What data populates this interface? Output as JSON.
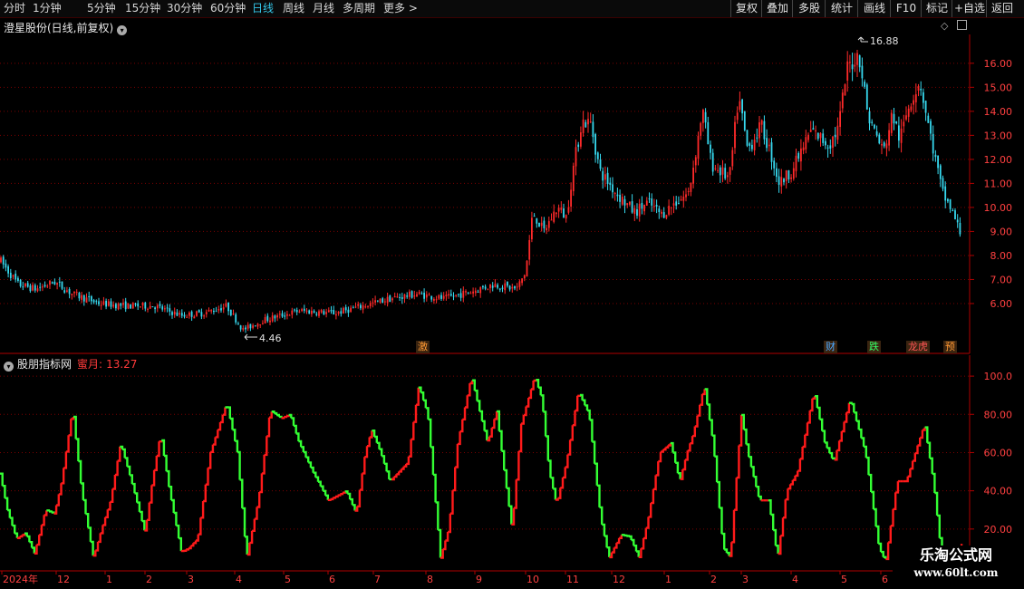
{
  "toolbar": {
    "periods": [
      "分时",
      "1分钟",
      "5分钟",
      "15分钟",
      "30分钟",
      "60分钟",
      "日线",
      "周线",
      "月线",
      "多周期",
      "更多"
    ],
    "active": "日线",
    "more_arrow": ">",
    "right_buttons": [
      "复权",
      "叠加",
      "多股",
      "统计",
      "画线",
      "F10",
      "标记",
      "+自选",
      "返回"
    ]
  },
  "stock": {
    "title": "澄星股份(日线,前复权)",
    "high_label": "16.88",
    "low_label": "4.46",
    "price_ticks": [
      "16.00",
      "15.00",
      "14.00",
      "13.00",
      "12.00",
      "11.00",
      "10.00",
      "9.00",
      "8.00",
      "7.00",
      "6.00"
    ]
  },
  "indicator": {
    "name": "股朋指标网",
    "value_label": "蜜月:",
    "value": "13.27",
    "ticks": [
      "100.0",
      "80.00",
      "60.00",
      "40.00",
      "20.00"
    ]
  },
  "events": [
    {
      "label": "激",
      "color": "#ff9933"
    },
    {
      "label": "财",
      "color": "#4aa8ff"
    },
    {
      "label": "跌",
      "color": "#33ff66"
    },
    {
      "label": "龙虎",
      "color": "#ff5555"
    },
    {
      "label": "预",
      "color": "#ff9933"
    }
  ],
  "time_axis": [
    "2024年",
    "12",
    "1",
    "2",
    "3",
    "4",
    "5",
    "6",
    "7",
    "8",
    "9",
    "10",
    "11",
    "12",
    "1",
    "2",
    "3",
    "4",
    "5",
    "6"
  ],
  "watermark": {
    "line1": "乐淘公式网",
    "line2": "www.60lt.com"
  },
  "colors": {
    "up": "#ff2a2a",
    "down": "#36d8ee",
    "ind_up": "#ff1a1a",
    "ind_down": "#33ff33",
    "axis": "#b00000",
    "grid": "#7a0000",
    "active": "#34c6e8"
  },
  "chart_data": [
    {
      "type": "candlestick",
      "title": "澄星股份(日线,前复权)",
      "ylim": [
        4.0,
        17.2
      ],
      "annotations": [
        {
          "text": "16.88",
          "value": 16.88
        },
        {
          "text": "4.46",
          "value": 4.46
        }
      ],
      "keypoints": [
        [
          0,
          7.8
        ],
        [
          20,
          6.8
        ],
        [
          40,
          6.6
        ],
        [
          60,
          6.9
        ],
        [
          80,
          6.4
        ],
        [
          110,
          6.0
        ],
        [
          140,
          5.9
        ],
        [
          170,
          5.9
        ],
        [
          200,
          5.5
        ],
        [
          225,
          5.6
        ],
        [
          250,
          5.9
        ],
        [
          268,
          4.9
        ],
        [
          290,
          5.3
        ],
        [
          330,
          5.7
        ],
        [
          370,
          5.6
        ],
        [
          400,
          5.9
        ],
        [
          430,
          6.2
        ],
        [
          460,
          6.4
        ],
        [
          490,
          6.2
        ],
        [
          520,
          6.5
        ],
        [
          545,
          6.8
        ],
        [
          570,
          6.6
        ],
        [
          580,
          7.3
        ],
        [
          588,
          9.8
        ],
        [
          600,
          9.0
        ],
        [
          615,
          10.0
        ],
        [
          625,
          9.6
        ],
        [
          632,
          11.5
        ],
        [
          642,
          13.6
        ],
        [
          652,
          13.5
        ],
        [
          662,
          11.5
        ],
        [
          680,
          10.6
        ],
        [
          700,
          9.8
        ],
        [
          715,
          10.2
        ],
        [
          730,
          9.7
        ],
        [
          745,
          10.2
        ],
        [
          760,
          10.6
        ],
        [
          770,
          12.8
        ],
        [
          775,
          14.1
        ],
        [
          785,
          11.8
        ],
        [
          805,
          11.2
        ],
        [
          815,
          14.6
        ],
        [
          825,
          12.4
        ],
        [
          840,
          13.4
        ],
        [
          850,
          12.3
        ],
        [
          860,
          11.0
        ],
        [
          875,
          11.6
        ],
        [
          895,
          13.2
        ],
        [
          915,
          12.6
        ],
        [
          925,
          13.3
        ],
        [
          935,
          15.8
        ],
        [
          948,
          16.4
        ],
        [
          958,
          13.8
        ],
        [
          975,
          12.3
        ],
        [
          985,
          13.9
        ],
        [
          993,
          12.8
        ],
        [
          1003,
          14.3
        ],
        [
          1015,
          15.3
        ],
        [
          1025,
          13.3
        ],
        [
          1040,
          10.6
        ],
        [
          1050,
          9.9
        ],
        [
          1062,
          8.7
        ]
      ]
    },
    {
      "type": "line",
      "title": "股朋指标网",
      "ylim": [
        0,
        110
      ],
      "series": [
        {
          "name": "蜜月",
          "last_value": 13.27,
          "keypoints": [
            [
              0,
              49
            ],
            [
              8,
              30
            ],
            [
              18,
              15
            ],
            [
              28,
              18
            ],
            [
              38,
              7
            ],
            [
              50,
              30
            ],
            [
              60,
              28
            ],
            [
              68,
              45
            ],
            [
              80,
              83
            ],
            [
              90,
              40
            ],
            [
              103,
              5
            ],
            [
              112,
              20
            ],
            [
              122,
              35
            ],
            [
              133,
              65
            ],
            [
              145,
              45
            ],
            [
              160,
              18
            ],
            [
              168,
              45
            ],
            [
              177,
              70
            ],
            [
              187,
              40
            ],
            [
              200,
              8
            ],
            [
              208,
              10
            ],
            [
              218,
              15
            ],
            [
              232,
              60
            ],
            [
              250,
              86
            ],
            [
              262,
              60
            ],
            [
              272,
              5
            ],
            [
              285,
              35
            ],
            [
              298,
              82
            ],
            [
              310,
              78
            ],
            [
              320,
              80
            ],
            [
              330,
              65
            ],
            [
              345,
              50
            ],
            [
              362,
              35
            ],
            [
              382,
              40
            ],
            [
              393,
              28
            ],
            [
              403,
              60
            ],
            [
              410,
              72
            ],
            [
              420,
              60
            ],
            [
              430,
              45
            ],
            [
              440,
              50
            ],
            [
              450,
              55
            ],
            [
              462,
              95
            ],
            [
              472,
              80
            ],
            [
              486,
              5
            ],
            [
              495,
              20
            ],
            [
              505,
              65
            ],
            [
              520,
              100
            ],
            [
              530,
              80
            ],
            [
              538,
              65
            ],
            [
              548,
              82
            ],
            [
              555,
              55
            ],
            [
              565,
              20
            ],
            [
              575,
              75
            ],
            [
              590,
              100
            ],
            [
              598,
              88
            ],
            [
              606,
              50
            ],
            [
              614,
              33
            ],
            [
              625,
              55
            ],
            [
              638,
              92
            ],
            [
              650,
              80
            ],
            [
              663,
              25
            ],
            [
              672,
              5
            ],
            [
              685,
              17
            ],
            [
              695,
              16
            ],
            [
              705,
              5
            ],
            [
              715,
              25
            ],
            [
              728,
              60
            ],
            [
              740,
              65
            ],
            [
              750,
              45
            ],
            [
              758,
              60
            ],
            [
              765,
              70
            ],
            [
              777,
              95
            ],
            [
              787,
              65
            ],
            [
              798,
              10
            ],
            [
              806,
              5
            ],
            [
              818,
              80
            ],
            [
              825,
              60
            ],
            [
              838,
              35
            ],
            [
              848,
              35
            ],
            [
              858,
              5
            ],
            [
              868,
              40
            ],
            [
              880,
              50
            ],
            [
              898,
              92
            ],
            [
              910,
              65
            ],
            [
              920,
              55
            ],
            [
              938,
              88
            ],
            [
              955,
              60
            ],
            [
              970,
              10
            ],
            [
              977,
              3
            ],
            [
              990,
              45
            ],
            [
              1000,
              45
            ],
            [
              1020,
              75
            ],
            [
              1030,
              45
            ],
            [
              1038,
              10
            ],
            [
              1040,
              10
            ],
            [
              1055,
              5
            ],
            [
              1062,
              13.27
            ]
          ]
        }
      ]
    }
  ]
}
